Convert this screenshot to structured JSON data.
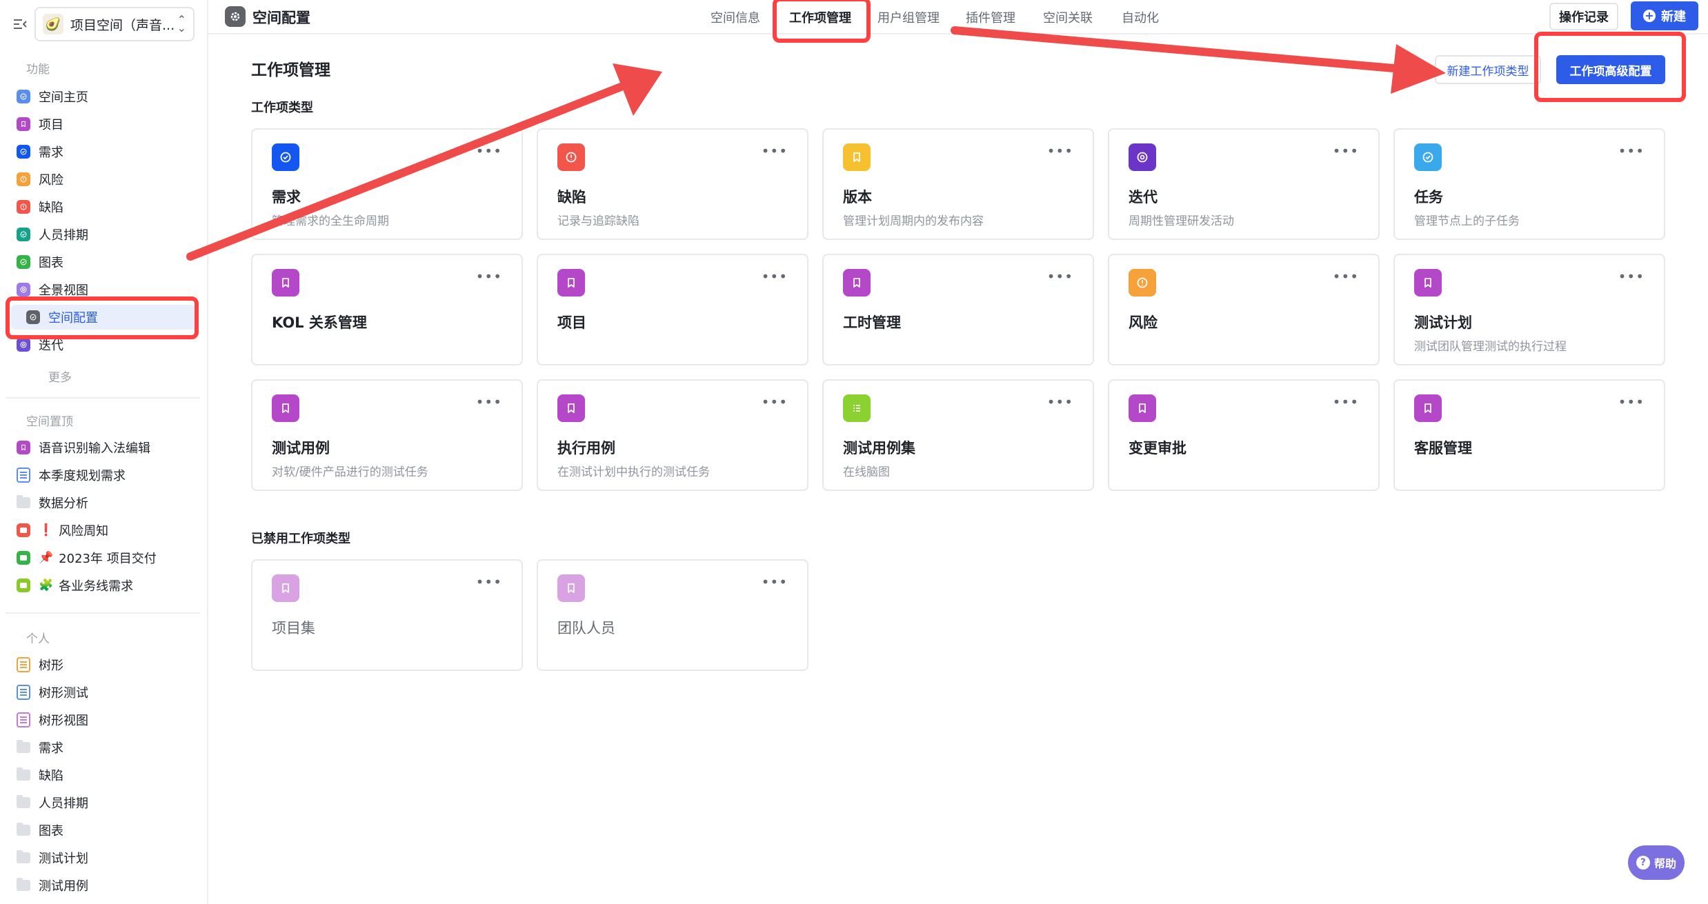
{
  "sidebar": {
    "space_name": "项目空间（声音...",
    "sections": {
      "features": "功能",
      "pinned": "空间置顶",
      "personal": "个人"
    },
    "feature_items": [
      {
        "label": "空间主页",
        "color": "#5b8def"
      },
      {
        "label": "项目",
        "color": "#b448c8"
      },
      {
        "label": "需求",
        "color": "#1456f0"
      },
      {
        "label": "风险",
        "color": "#f7a13b"
      },
      {
        "label": "缺陷",
        "color": "#f2564b"
      },
      {
        "label": "人员排期",
        "color": "#14a28a"
      },
      {
        "label": "图表",
        "color": "#34b348"
      },
      {
        "label": "全景视图",
        "color": "#9f7aea"
      },
      {
        "label": "空间配置",
        "color": "#5f6368"
      },
      {
        "label": "迭代",
        "color": "#6b4fd8"
      }
    ],
    "more_label": "更多",
    "pinned_items": [
      {
        "label": "语音识别输入法编辑",
        "type": "bookmark",
        "color": "#b448c8"
      },
      {
        "label": "本季度规划需求",
        "type": "doc",
        "color": "#5b8def"
      },
      {
        "label": "数据分析",
        "type": "folder"
      },
      {
        "label": "风险周知",
        "type": "emoji",
        "color": "#f2564b",
        "emoji": "❗"
      },
      {
        "label": "2023年 项目交付",
        "type": "emoji",
        "color": "#34b348",
        "emoji": "📌"
      },
      {
        "label": "各业务线需求",
        "type": "emoji",
        "color": "#8bc926",
        "emoji": "🧩"
      }
    ],
    "personal_items": [
      {
        "label": "树形",
        "type": "doc",
        "color": "#f7a13b"
      },
      {
        "label": "树形测试",
        "type": "doc",
        "color": "#5b8def"
      },
      {
        "label": "树形视图",
        "type": "doc",
        "color": "#c178e0"
      },
      {
        "label": "需求",
        "type": "folder"
      },
      {
        "label": "缺陷",
        "type": "folder"
      },
      {
        "label": "人员排期",
        "type": "folder"
      },
      {
        "label": "图表",
        "type": "folder"
      },
      {
        "label": "测试计划",
        "type": "folder"
      },
      {
        "label": "测试用例",
        "type": "folder"
      }
    ]
  },
  "topbar": {
    "title": "空间配置",
    "tabs": [
      "空间信息",
      "工作项管理",
      "用户组管理",
      "插件管理",
      "空间关联",
      "自动化"
    ],
    "active_tab": "工作项管理",
    "log_button": "操作记录",
    "new_button": "新建"
  },
  "main": {
    "title": "工作项管理",
    "new_type_button": "新建工作项类型",
    "advanced_button": "工作项高级配置",
    "types_heading": "工作项类型",
    "disabled_heading": "已禁用工作项类型",
    "types": [
      {
        "name": "需求",
        "desc": "管理需求的全生命周期",
        "color": "#1456f0",
        "icon": "check"
      },
      {
        "name": "缺陷",
        "desc": "记录与追踪缺陷",
        "color": "#f2564b",
        "icon": "alert"
      },
      {
        "name": "版本",
        "desc": "管理计划周期内的发布内容",
        "color": "#f5c12e",
        "icon": "bookmark"
      },
      {
        "name": "迭代",
        "desc": "周期性管理研发活动",
        "color": "#6b36c8",
        "icon": "cycle"
      },
      {
        "name": "任务",
        "desc": "管理节点上的子任务",
        "color": "#3aa9ec",
        "icon": "check"
      },
      {
        "name": "KOL 关系管理",
        "desc": "",
        "color": "#b448c8",
        "icon": "bookmark"
      },
      {
        "name": "项目",
        "desc": "",
        "color": "#b448c8",
        "icon": "bookmark"
      },
      {
        "name": "工时管理",
        "desc": "",
        "color": "#b448c8",
        "icon": "bookmark"
      },
      {
        "name": "风险",
        "desc": "",
        "color": "#f7a13b",
        "icon": "alert"
      },
      {
        "name": "测试计划",
        "desc": "测试团队管理测试的执行过程",
        "color": "#b448c8",
        "icon": "bookmark"
      },
      {
        "name": "测试用例",
        "desc": "对软/硬件产品进行的测试任务",
        "color": "#b448c8",
        "icon": "bookmark"
      },
      {
        "name": "执行用例",
        "desc": "在测试计划中执行的测试任务",
        "color": "#b448c8",
        "icon": "bookmark"
      },
      {
        "name": "测试用例集",
        "desc": "在线脑图",
        "color": "#8bd12f",
        "icon": "list"
      },
      {
        "name": "变更审批",
        "desc": "",
        "color": "#b448c8",
        "icon": "bookmark"
      },
      {
        "name": "客服管理",
        "desc": "",
        "color": "#b448c8",
        "icon": "bookmark"
      }
    ],
    "disabled_types": [
      {
        "name": "项目集",
        "desc": "",
        "color": "#d9a2e3",
        "icon": "bookmark"
      },
      {
        "name": "团队人员",
        "desc": "",
        "color": "#d9a2e3",
        "icon": "bookmark"
      }
    ]
  },
  "help_button": "帮助",
  "annotation_color": "#ff4040"
}
